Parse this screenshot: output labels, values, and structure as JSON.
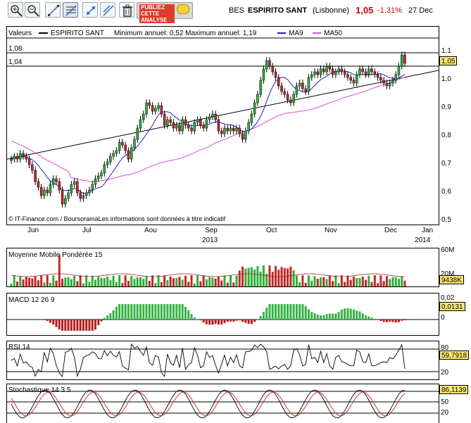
{
  "toolbar": {
    "buttons": [
      {
        "id": "zoom-in",
        "icon": "zoom-in-icon"
      },
      {
        "id": "zoom-out",
        "icon": "zoom-out-icon"
      },
      {
        "id": "line-tool",
        "icon": "line-tool-icon"
      },
      {
        "id": "fibonacci",
        "icon": "fibonacci-icon"
      },
      {
        "id": "move",
        "icon": "move-icon"
      },
      {
        "id": "trend",
        "icon": "trend-icon"
      },
      {
        "id": "delete",
        "icon": "trash-icon"
      }
    ],
    "publiez": [
      "PUBLIEZ",
      "CETTE",
      "ANALYSE"
    ]
  },
  "header": {
    "ticker": "BES",
    "name": "ESPIRITO SANT",
    "market": "(Lisbonne)",
    "price": "1,05",
    "change": "-1,31%",
    "date": "27 Dec"
  },
  "legend": {
    "valeurs": "Valeurs",
    "series": "ESPIRITO SANT",
    "minmax": "Minimum annuel: 0,52 Maximum annuel: 1,19",
    "ma9": "MA9",
    "ma50": "MA50"
  },
  "level_labels": {
    "upper": "1,08",
    "lower": "1,04"
  },
  "price_tag": "1,05",
  "copyright": "© IT-Finance.com / BoursoramaLes informations sont données à titre indicatif",
  "x_axis": {
    "months": [
      "Jun",
      "Jul",
      "Aou",
      "Sep",
      "Oct",
      "Nov",
      "Dec",
      "Jan"
    ],
    "years": [
      "2013",
      "2014"
    ]
  },
  "panels": {
    "volume": {
      "title": "Moyenne Mobile Pondérée 15",
      "ticks": [
        "60M",
        "20M"
      ],
      "value": "9438K"
    },
    "macd": {
      "title": "MACD 12 26 9",
      "ticks": [
        "0,02",
        "0"
      ],
      "value": "0,0131"
    },
    "rsi": {
      "title": "RSI 14",
      "ticks": [
        "80",
        "20"
      ],
      "value": "59,7918"
    },
    "stoch": {
      "title": "Stochastique 14 3 5",
      "ticks": [
        "80",
        "50",
        "20"
      ],
      "value": "86,1139"
    }
  },
  "colors": {
    "up": "#2fae3a",
    "down": "#c0282a",
    "ma9": "#2020c0",
    "ma50": "#d64fd0",
    "tag": "#ffe873",
    "change": "#cc0000",
    "macd_up": "#33b343",
    "macd_down": "#b11f1f"
  },
  "chart_data": {
    "type": "candlestick",
    "x": [
      "Jun",
      "Jul",
      "Aou",
      "Sep",
      "Oct",
      "Nov",
      "Dec",
      "Jan"
    ],
    "y_ticks": [
      0.5,
      0.6,
      0.7,
      0.8,
      0.9,
      1.0,
      1.1
    ],
    "ylim": [
      0.49,
      1.14
    ],
    "close": [
      0.72,
      0.73,
      0.72,
      0.74,
      0.73,
      0.72,
      0.7,
      0.68,
      0.64,
      0.62,
      0.59,
      0.61,
      0.6,
      0.63,
      0.65,
      0.64,
      0.61,
      0.56,
      0.58,
      0.6,
      0.63,
      0.64,
      0.6,
      0.58,
      0.59,
      0.6,
      0.61,
      0.63,
      0.65,
      0.66,
      0.67,
      0.7,
      0.71,
      0.73,
      0.74,
      0.75,
      0.78,
      0.77,
      0.75,
      0.72,
      0.76,
      0.79,
      0.83,
      0.86,
      0.88,
      0.92,
      0.91,
      0.89,
      0.9,
      0.91,
      0.88,
      0.84,
      0.86,
      0.85,
      0.83,
      0.84,
      0.82,
      0.86,
      0.84,
      0.83,
      0.82,
      0.85,
      0.86,
      0.84,
      0.83,
      0.86,
      0.87,
      0.88,
      0.86,
      0.82,
      0.81,
      0.83,
      0.82,
      0.83,
      0.82,
      0.83,
      0.81,
      0.79,
      0.82,
      0.85,
      0.88,
      0.92,
      0.95,
      1.0,
      1.04,
      1.07,
      1.05,
      1.03,
      1.01,
      0.98,
      0.96,
      0.95,
      0.93,
      0.92,
      0.95,
      0.98,
      0.99,
      0.97,
      0.96,
      1.01,
      1.02,
      1.03,
      1.02,
      1.04,
      1.03,
      1.05,
      1.04,
      1.02,
      1.03,
      1.04,
      1.03,
      1.02,
      1.01,
      1.0,
      0.99,
      1.02,
      1.04,
      1.03,
      1.02,
      1.04,
      1.03,
      1.02,
      1.01,
      1.0,
      0.99,
      0.98,
      0.99,
      1.0,
      1.02,
      1.05,
      1.09,
      1.06
    ],
    "ma9_label": "MA9",
    "ma50_label": "MA50",
    "levels": [
      1.08,
      1.04
    ]
  }
}
